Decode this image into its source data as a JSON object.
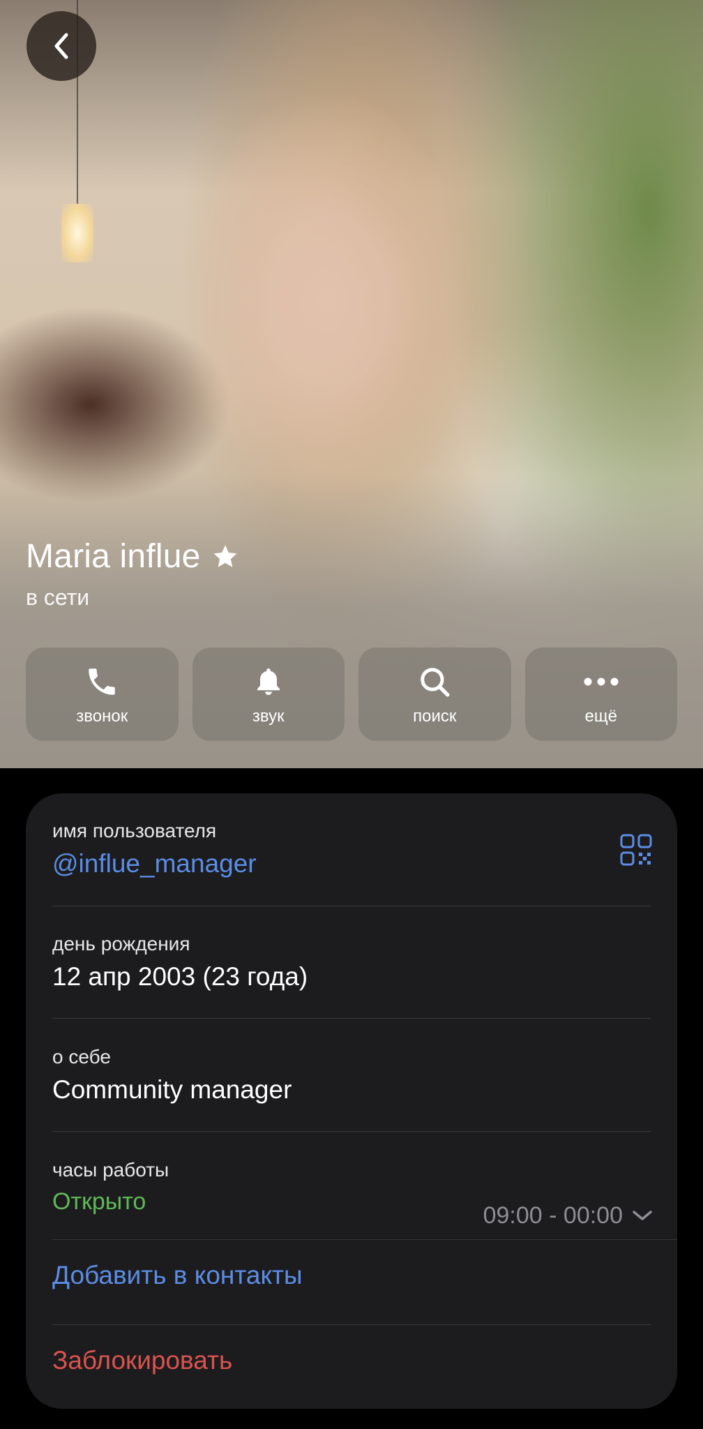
{
  "profile": {
    "name": "Maria influe",
    "status": "в сети"
  },
  "actions": [
    {
      "label": "звонок",
      "icon": "phone-icon"
    },
    {
      "label": "звук",
      "icon": "bell-icon"
    },
    {
      "label": "поиск",
      "icon": "search-icon"
    },
    {
      "label": "ещё",
      "icon": "more-icon"
    }
  ],
  "info": {
    "username_label": "имя пользователя",
    "username_value": "@influe_manager",
    "birthday_label": "день рождения",
    "birthday_value": "12 апр 2003 (23 года)",
    "about_label": "о себе",
    "about_value": "Community manager",
    "hours_label": "часы работы",
    "hours_status": "Открыто",
    "hours_range": "09:00 - 00:00",
    "add_contact": "Добавить в контакты",
    "block": "Заблокировать"
  },
  "colors": {
    "link": "#5b8de6",
    "open": "#5fb957",
    "destructive": "#d9534f",
    "card": "#1c1c1e"
  }
}
